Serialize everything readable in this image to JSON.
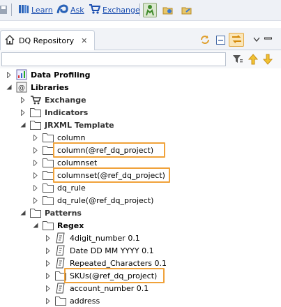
{
  "toolbar": {
    "learn_label": "Learn",
    "ask_label": "Ask",
    "exchange_label": "Exchange"
  },
  "view": {
    "tab_title": "DQ Repository",
    "tab_close": "✕"
  },
  "filter": {
    "value": "",
    "placeholder": ""
  },
  "tree": {
    "data_profiling": "Data Profiling",
    "libraries": "Libraries",
    "exchange": "Exchange",
    "indicators": "Indicators",
    "jrxml_template": "JRXML Template",
    "jrxml_children": [
      "column",
      "column(@ref_dq_project)",
      "columnset",
      "columnset(@ref_dq_project)",
      "dq_rule",
      "dq_rule(@ref_dq_project)"
    ],
    "patterns": "Patterns",
    "regex": "Regex",
    "regex_children": [
      "4digit_number 0.1",
      "Date DD MM YYYY 0.1",
      "Repeated_Characters 0.1",
      "SKUs(@ref_dq_project)",
      "account_number 0.1",
      "address"
    ]
  },
  "colors": {
    "highlight": "#f0a23a",
    "link": "#1c4fb0",
    "folder_stroke": "#555555"
  }
}
